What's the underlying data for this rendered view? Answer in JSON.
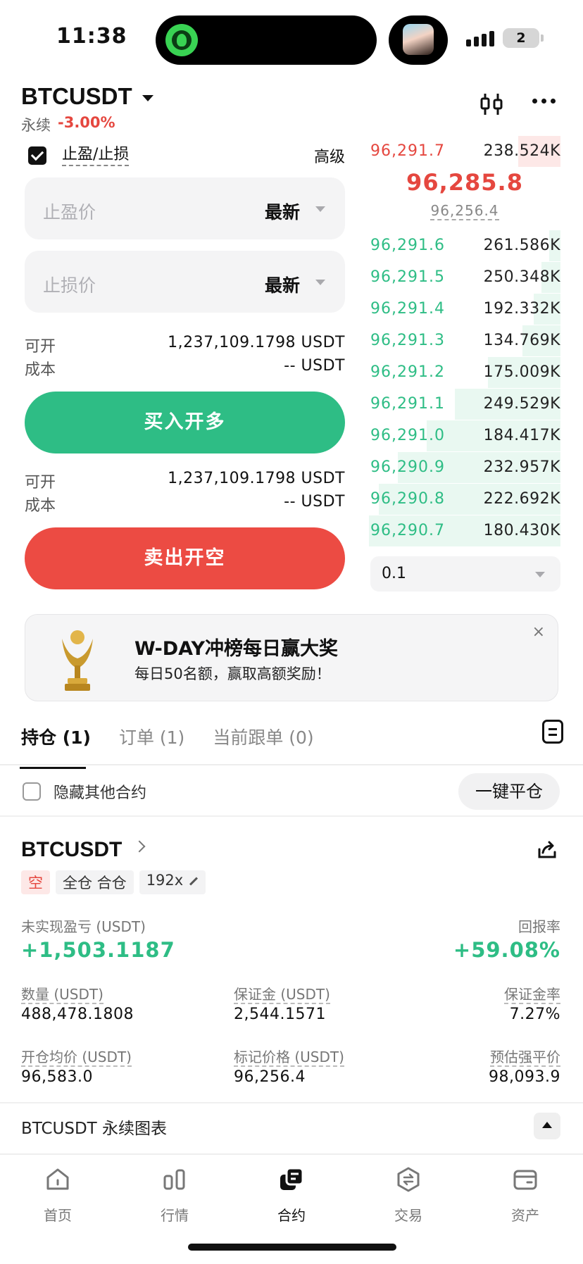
{
  "status": {
    "time": "11:38",
    "battery": "2"
  },
  "header": {
    "symbol": "BTCUSDT",
    "contract_type": "永续",
    "change": "-3.00%",
    "icons": [
      "candlestick-chart-icon",
      "more-horizontal-icon"
    ]
  },
  "trade": {
    "tpsl_label": "止盈/止损",
    "advanced_label": "高级",
    "tp_placeholder": "止盈价",
    "tp_type": "最新",
    "sl_placeholder": "止损价",
    "sl_type": "最新",
    "long": {
      "available_label": "可开",
      "available_value": "1,237,109.1798 USDT",
      "cost_label": "成本",
      "cost_value": "-- USDT",
      "button": "买入开多"
    },
    "short": {
      "available_label": "可开",
      "available_value": "1,237,109.1798 USDT",
      "cost_label": "成本",
      "cost_value": "-- USDT",
      "button": "卖出开空"
    }
  },
  "orderbook": {
    "asks": [
      {
        "price": "96,291.7",
        "qty": "238.524K",
        "depth": 0.22
      }
    ],
    "last_price": "96,285.8",
    "mark_price": "96,256.4",
    "bids": [
      {
        "price": "96,291.6",
        "qty": "261.586K",
        "depth": 0.06
      },
      {
        "price": "96,291.5",
        "qty": "250.348K",
        "depth": 0.1
      },
      {
        "price": "96,291.4",
        "qty": "192.332K",
        "depth": 0.14
      },
      {
        "price": "96,291.3",
        "qty": "134.769K",
        "depth": 0.2
      },
      {
        "price": "96,291.2",
        "qty": "175.009K",
        "depth": 0.38
      },
      {
        "price": "96,291.1",
        "qty": "249.529K",
        "depth": 0.55
      },
      {
        "price": "96,291.0",
        "qty": "184.417K",
        "depth": 0.7
      },
      {
        "price": "96,290.9",
        "qty": "232.957K",
        "depth": 0.85
      },
      {
        "price": "96,290.8",
        "qty": "222.692K",
        "depth": 0.95
      },
      {
        "price": "96,290.7",
        "qty": "180.430K",
        "depth": 1.0
      }
    ],
    "step": "0.1"
  },
  "banner": {
    "title": "W-DAY冲榜每日赢大奖",
    "subtitle": "每日50名额，赢取高额奖励！",
    "close": "×"
  },
  "tabs": [
    {
      "label": "持仓 (1)",
      "active": true
    },
    {
      "label": "订单 (1)",
      "active": false
    },
    {
      "label": "当前跟单 (0)",
      "active": false
    }
  ],
  "positions_bar": {
    "hide_label": "隐藏其他合约",
    "close_all": "一键平仓"
  },
  "position": {
    "symbol": "BTCUSDT",
    "side_tag": "空",
    "margin_tag": "全仓 合仓",
    "leverage_tag": "192x",
    "pnl_label": "未实现盈亏 (USDT)",
    "pnl_value": "+1,503.1187",
    "roe_label": "回报率",
    "roe_value": "+59.08%",
    "qty_label": "数量 (USDT)",
    "qty_value": "488,478.1808",
    "margin_label": "保证金 (USDT)",
    "margin_value": "2,544.1571",
    "margin_ratio_label": "保证金率",
    "margin_ratio_value": "7.27%",
    "entry_label": "开仓均价 (USDT)",
    "entry_value": "96,583.0",
    "mark_label": "标记价格 (USDT)",
    "mark_value": "96,256.4",
    "liq_label": "预估强平价",
    "liq_value": "98,093.9"
  },
  "chart_row": {
    "label": "BTCUSDT 永续图表"
  },
  "nav": [
    {
      "label": "首页",
      "icon": "home-icon",
      "active": false
    },
    {
      "label": "行情",
      "icon": "markets-icon",
      "active": false
    },
    {
      "label": "合约",
      "icon": "futures-icon",
      "active": true
    },
    {
      "label": "交易",
      "icon": "trade-icon",
      "active": false
    },
    {
      "label": "资产",
      "icon": "wallet-icon",
      "active": false
    }
  ],
  "colors": {
    "buy": "#2ebd85",
    "sell": "#ec4b43",
    "text": "#111111"
  }
}
